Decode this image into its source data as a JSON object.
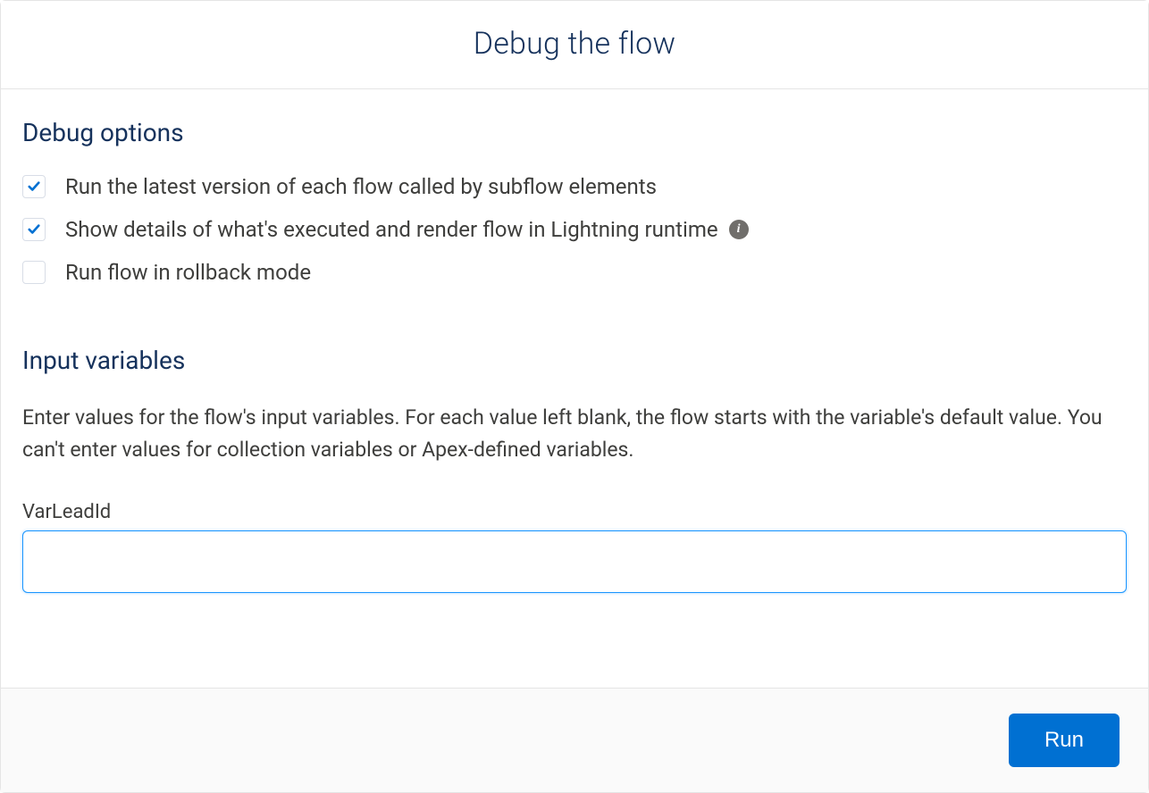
{
  "header": {
    "title": "Debug the flow"
  },
  "debugOptions": {
    "heading": "Debug options",
    "items": [
      {
        "label": "Run the latest version of each flow called by subflow elements",
        "checked": true,
        "info": false
      },
      {
        "label": "Show details of what's executed and render flow in Lightning runtime",
        "checked": true,
        "info": true
      },
      {
        "label": "Run flow in rollback mode",
        "checked": false,
        "info": false
      }
    ]
  },
  "inputVariables": {
    "heading": "Input variables",
    "help": "Enter values for the flow's input variables. For each value left blank, the flow starts with the variable's default value. You can't enter values for collection variables or Apex-defined variables.",
    "fields": [
      {
        "label": "VarLeadId",
        "value": ""
      }
    ]
  },
  "footer": {
    "runLabel": "Run"
  },
  "infoGlyph": "i"
}
